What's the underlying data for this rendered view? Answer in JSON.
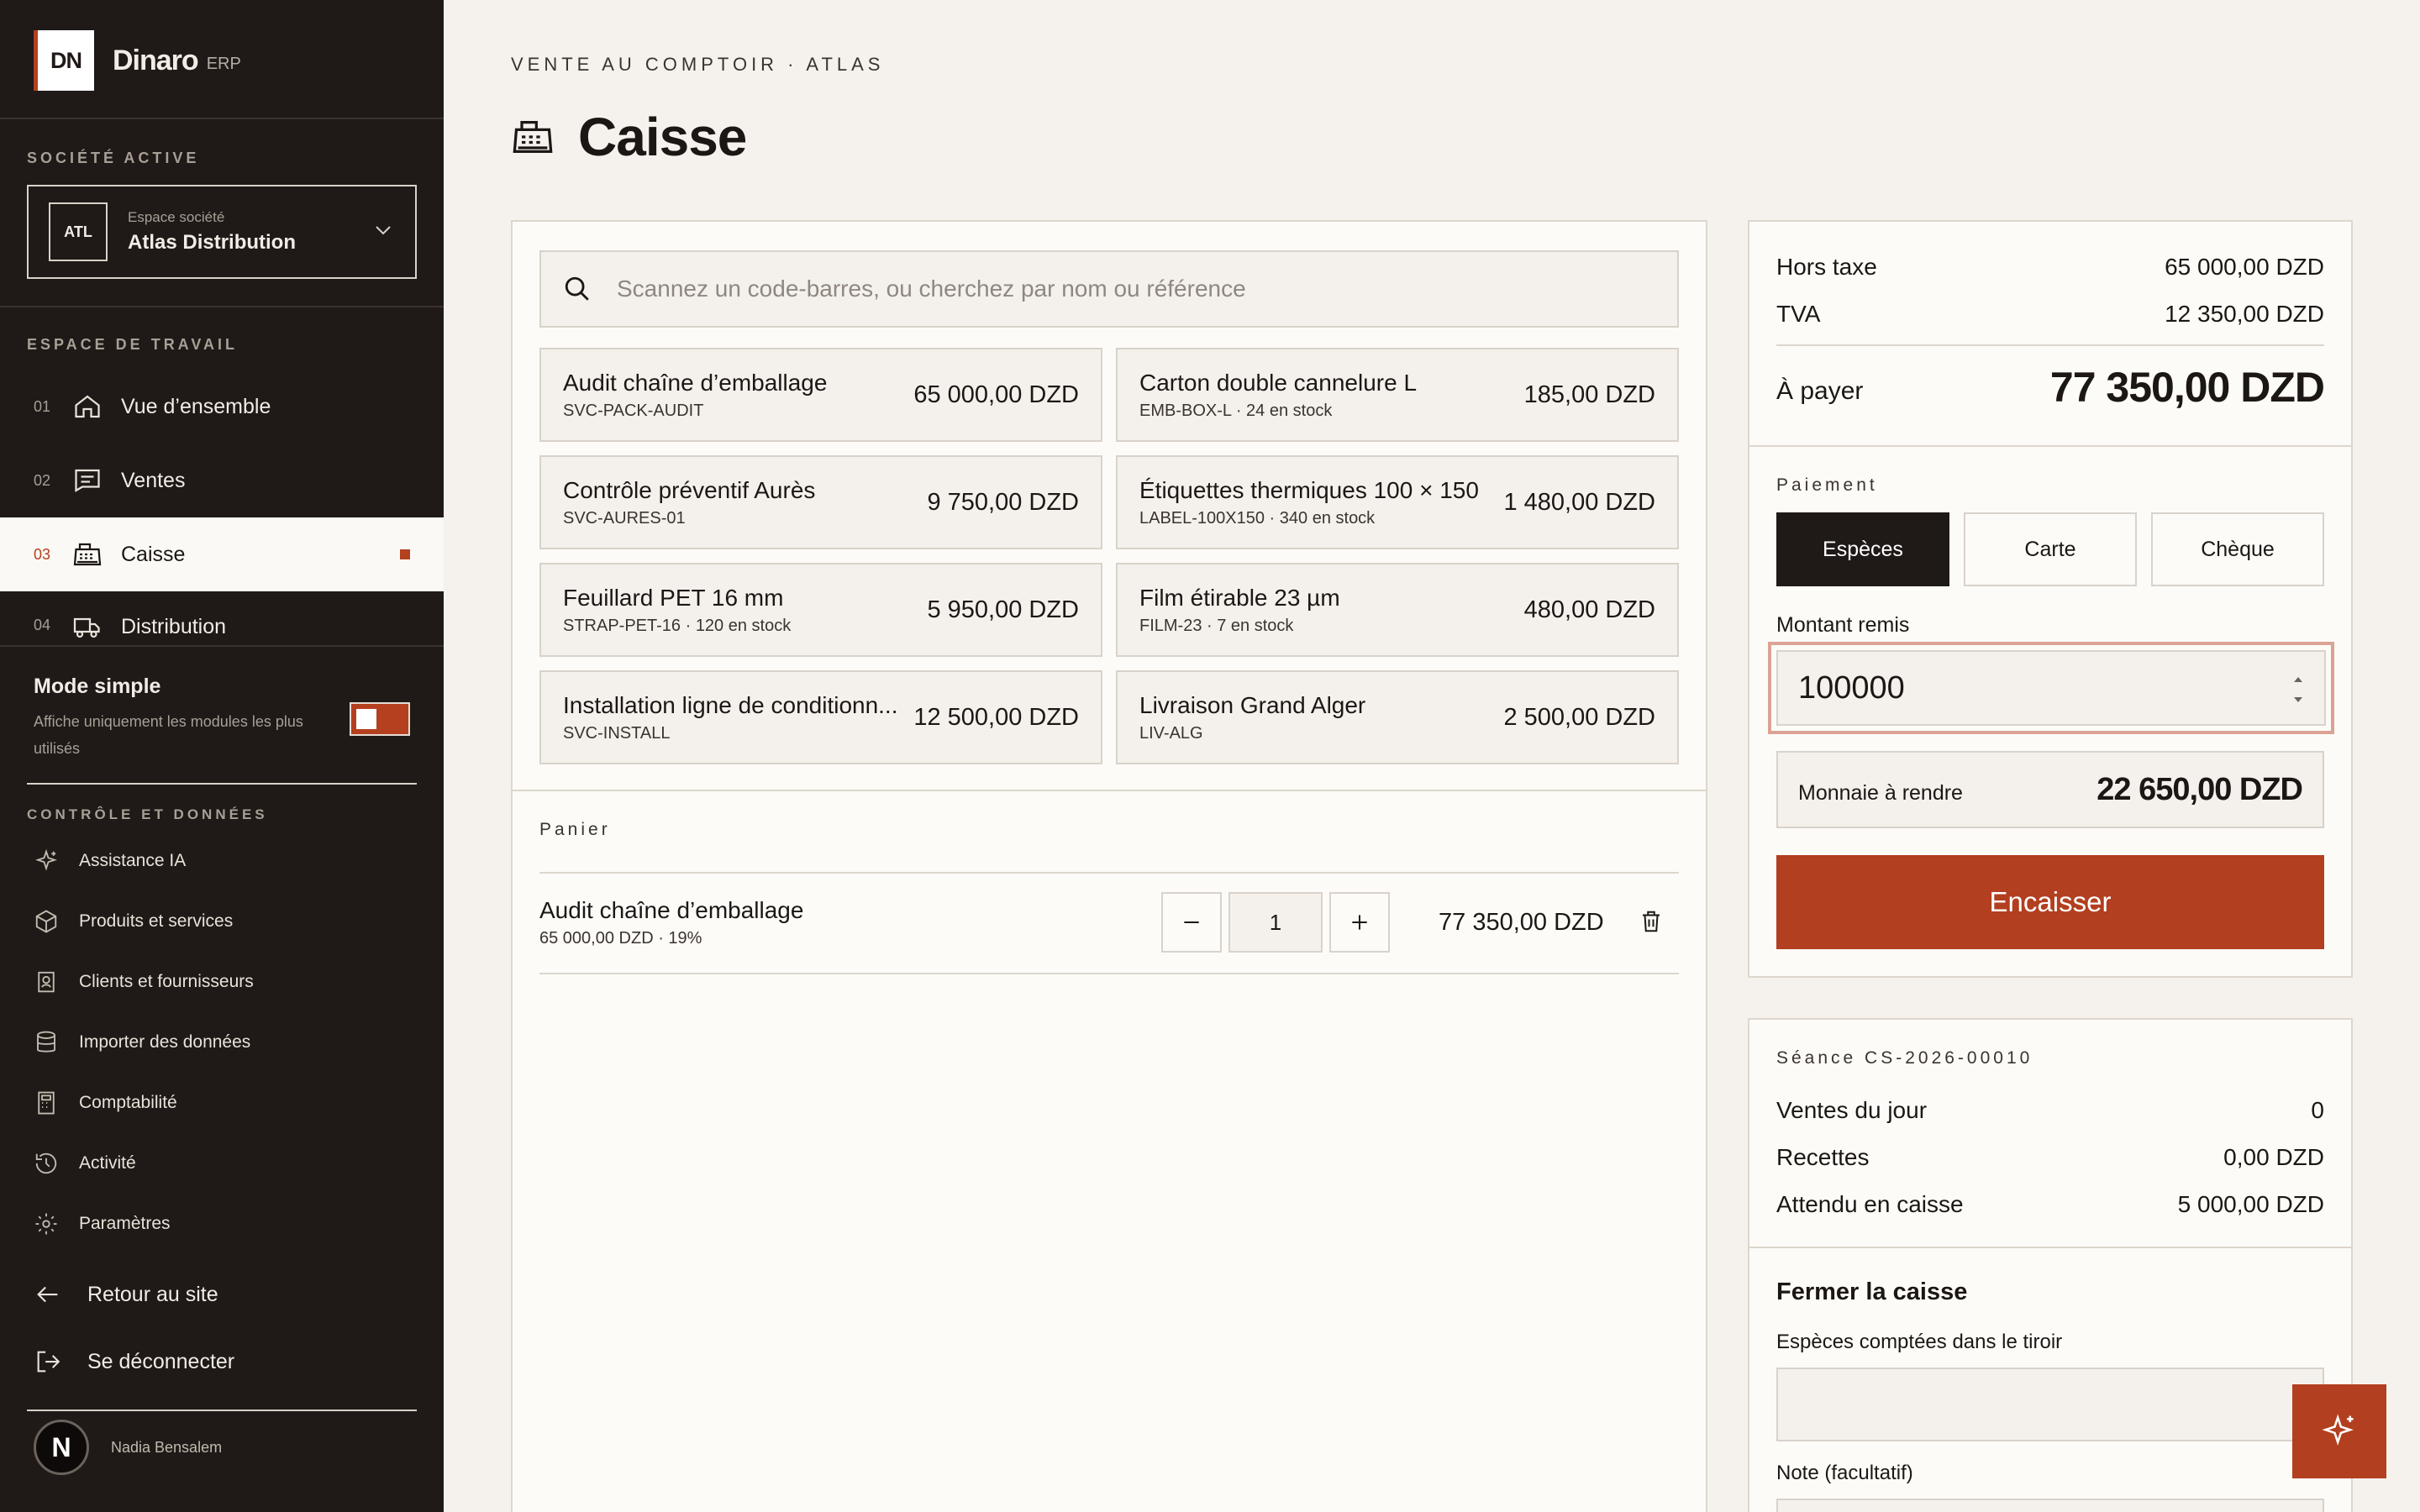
{
  "brand": {
    "logo": "DN",
    "name": "Dinaro",
    "suffix": "ERP"
  },
  "sidebar": {
    "company_section": "SOCIÉTÉ ACTIVE",
    "company": {
      "badge": "ATL",
      "caption": "Espace société",
      "name": "Atlas Distribution"
    },
    "workspace_section": "ESPACE DE TRAVAIL",
    "nav": [
      {
        "num": "01",
        "label": "Vue d’ensemble",
        "icon": "home-icon"
      },
      {
        "num": "02",
        "label": "Ventes",
        "icon": "receipt-icon"
      },
      {
        "num": "03",
        "label": "Caisse",
        "icon": "cash-register-icon",
        "active": true
      },
      {
        "num": "04",
        "label": "Distribution",
        "icon": "truck-icon"
      }
    ],
    "simple_mode": {
      "title": "Mode simple",
      "desc": "Affiche uniquement les modules les plus utilisés",
      "on": true
    },
    "control_section": "CONTRÔLE ET DONNÉES",
    "control_items": [
      {
        "label": "Assistance IA",
        "icon": "sparkle-icon"
      },
      {
        "label": "Produits et services",
        "icon": "box-icon"
      },
      {
        "label": "Clients et fournisseurs",
        "icon": "contact-icon"
      },
      {
        "label": "Importer des données",
        "icon": "database-icon"
      },
      {
        "label": "Comptabilité",
        "icon": "calculator-icon"
      },
      {
        "label": "Activité",
        "icon": "history-icon"
      },
      {
        "label": "Paramètres",
        "icon": "gear-icon"
      }
    ],
    "back_link": "Retour au site",
    "logout": "Se déconnecter",
    "user": {
      "initial": "N",
      "name": "Nadia Bensalem"
    }
  },
  "page": {
    "breadcrumb": "VENTE AU COMPTOIR · ATLAS",
    "title": "Caisse"
  },
  "search": {
    "placeholder": "Scannez un code-barres, ou cherchez par nom ou référence"
  },
  "products": [
    {
      "name": "Audit chaîne d’emballage",
      "meta": "SVC-PACK-AUDIT",
      "price": "65 000,00 DZD"
    },
    {
      "name": "Carton double cannelure L",
      "meta": "EMB-BOX-L · 24 en stock",
      "price": "185,00 DZD"
    },
    {
      "name": "Contrôle préventif Aurès",
      "meta": "SVC-AURES-01",
      "price": "9 750,00 DZD"
    },
    {
      "name": "Étiquettes thermiques 100 × 150",
      "meta": "LABEL-100X150 · 340 en stock",
      "price": "1 480,00 DZD"
    },
    {
      "name": "Feuillard PET 16 mm",
      "meta": "STRAP-PET-16 · 120 en stock",
      "price": "5 950,00 DZD"
    },
    {
      "name": "Film étirable 23 µm",
      "meta": "FILM-23 · 7 en stock",
      "price": "480,00 DZD"
    },
    {
      "name": "Installation ligne de conditionn...",
      "meta": "SVC-INSTALL",
      "price": "12 500,00 DZD"
    },
    {
      "name": "Livraison Grand Alger",
      "meta": "LIV-ALG",
      "price": "2 500,00 DZD"
    }
  ],
  "cart": {
    "label": "Panier",
    "items": [
      {
        "name": "Audit chaîne d’emballage",
        "meta": "65 000,00 DZD · 19%",
        "qty": "1",
        "total": "77 350,00 DZD"
      }
    ]
  },
  "totals": {
    "ht_label": "Hors taxe",
    "ht": "65 000,00 DZD",
    "tva_label": "TVA",
    "tva": "12 350,00 DZD",
    "topay_label": "À payer",
    "topay": "77 350,00 DZD"
  },
  "payment": {
    "label": "Paiement",
    "methods": [
      "Espèces",
      "Carte",
      "Chèque"
    ],
    "selected": "Espèces",
    "amount_label": "Montant remis",
    "amount": "100000",
    "change_label": "Monnaie à rendre",
    "change": "22 650,00 DZD",
    "submit": "Encaisser"
  },
  "session": {
    "label": "Séance CS-2026-00010",
    "rows": [
      {
        "label": "Ventes du jour",
        "value": "0"
      },
      {
        "label": "Recettes",
        "value": "0,00 DZD"
      },
      {
        "label": "Attendu en caisse",
        "value": "5 000,00 DZD"
      }
    ],
    "close_title": "Fermer la caisse",
    "drawer_label": "Espèces comptées dans le tiroir",
    "note_label": "Note (facultatif)"
  },
  "colors": {
    "accent": "#b4401f",
    "sidebar_bg": "#1f1917",
    "page_bg": "#f5f2ed"
  }
}
